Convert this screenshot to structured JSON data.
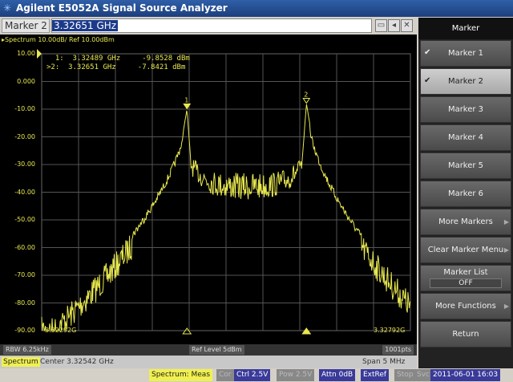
{
  "window": {
    "title": "Agilent E5052A Signal Source Analyzer"
  },
  "entry": {
    "label": "Marker 2",
    "value": "3.32651 GHz"
  },
  "trace": {
    "header": "Spectrum 10.00dB/ Ref 10.00dBm",
    "ref_value": "10.00",
    "y_ticks": [
      "10.00",
      "0.000",
      "-10.00",
      "-20.00",
      "-30.00",
      "-40.00",
      "-50.00",
      "-60.00",
      "-70.00",
      "-80.00",
      "-90.00"
    ],
    "start": "3.32292G",
    "stop": "3.32792G",
    "trace_color": "#e8e850"
  },
  "markers": [
    {
      "line": "  1:  3.32489 GHz     -9.8528 dBm",
      "id": "1",
      "freq_ghz": 3.32489,
      "level_dbm": -9.8528
    },
    {
      "line": ">2:  3.32651 GHz     -7.8421 dBm",
      "id": "2",
      "freq_ghz": 3.32651,
      "level_dbm": -7.8421
    }
  ],
  "infobar": {
    "rbw": "RBW 6.25kHz",
    "ref_level": "Ref Level 5dBm",
    "points": "1001pts"
  },
  "chanbar": {
    "mode": "Spectrum",
    "center": "Center 3.32542 GHz",
    "span": "Span 5 MHz"
  },
  "status": {
    "meas": "Spectrum: Meas",
    "cor": "Cor",
    "ctrl": "Ctrl  2.5V",
    "pow": "Pow  2.5V",
    "attn": "Attn 0dB",
    "extref": "ExtRef",
    "stop": "Stop",
    "svc": "Svc",
    "datetime": "2011-06-01 16:03"
  },
  "softkeys": {
    "title": "Marker",
    "items": [
      {
        "label": "Marker 1",
        "checked": true
      },
      {
        "label": "Marker 2",
        "checked": true,
        "selected": true
      },
      {
        "label": "Marker 3"
      },
      {
        "label": "Marker 4"
      },
      {
        "label": "Marker 5"
      },
      {
        "label": "Marker 6"
      },
      {
        "label": "More Markers",
        "submenu": true
      },
      {
        "label": "Clear Marker Menu",
        "submenu": true
      },
      {
        "label": "Marker List",
        "value": "OFF"
      },
      {
        "label": "More Functions",
        "submenu": true
      },
      {
        "label": "Return"
      }
    ]
  }
}
